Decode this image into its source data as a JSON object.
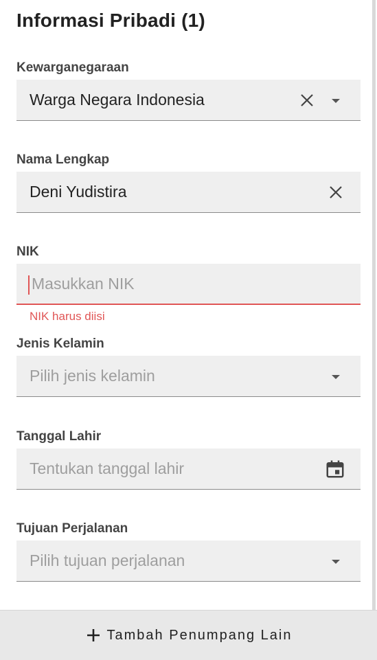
{
  "section": {
    "title": "Informasi Pribadi (1)"
  },
  "fields": {
    "citizenship": {
      "label": "Kewarganegaraan",
      "value": "Warga Negara Indonesia"
    },
    "full_name": {
      "label": "Nama Lengkap",
      "value": "Deni Yudistira"
    },
    "nik": {
      "label": "NIK",
      "placeholder": "Masukkan NIK",
      "error": "NIK harus diisi"
    },
    "gender": {
      "label": "Jenis Kelamin",
      "placeholder": "Pilih jenis kelamin"
    },
    "birth_date": {
      "label": "Tanggal Lahir",
      "placeholder": "Tentukan tanggal lahir"
    },
    "travel_purpose": {
      "label": "Tujuan Perjalanan",
      "placeholder": "Pilih tujuan perjalanan"
    }
  },
  "footer": {
    "add_passenger_label": "Tambah Penumpang Lain"
  },
  "colors": {
    "error": "#e05555",
    "field_bg": "#efefef",
    "placeholder": "#9e9e9e"
  },
  "icons": [
    "close-icon",
    "chevron-down-icon",
    "calendar-icon",
    "plus-icon"
  ]
}
